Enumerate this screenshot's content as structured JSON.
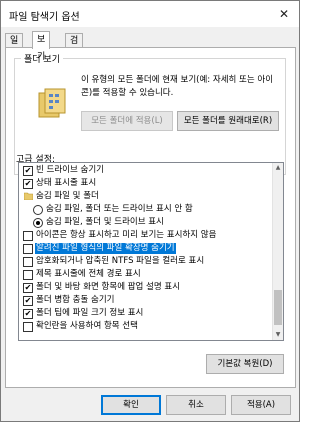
{
  "window": {
    "title": "파일 탐색기 옵션",
    "close_glyph": "✕"
  },
  "tabs": [
    {
      "label": "일반"
    },
    {
      "label": "보기",
      "active": true
    },
    {
      "label": "검색"
    }
  ],
  "folder_view": {
    "group_label": "폴더 보기",
    "description": "이 유형의 모든 폴더에 현재 보기(예: 자세히 또는 아이콘)를 적용할 수 있습니다.",
    "apply_button": "모든 폴더에 적용(L)",
    "reset_button": "모든 폴더를 원래대로(R)"
  },
  "advanced": {
    "label": "고급 설정:",
    "items": [
      {
        "text": "빈 드라이브 숨기기",
        "kind": "checkbox",
        "checked": true
      },
      {
        "text": "상태 표시줄 표시",
        "kind": "checkbox",
        "checked": true
      },
      {
        "text": "숨김 파일 및 폴더",
        "kind": "folder"
      },
      {
        "text": "숨김 파일, 폴더 또는 드라이브 표시 안 함",
        "kind": "radio",
        "checked": false
      },
      {
        "text": "숨김 파일, 폴더 및 드라이브 표시",
        "kind": "radio",
        "checked": true
      },
      {
        "text": "아이콘은 항상 표시하고 미리 보기는 표시하지 않음",
        "kind": "checkbox",
        "checked": false
      },
      {
        "text": "알려진 파일 형식의 파일 확장명 숨기기",
        "kind": "checkbox",
        "checked": false,
        "highlighted": true
      },
      {
        "text": "암호화되거나 압축된 NTFS 파일을 컬러로 표시",
        "kind": "checkbox",
        "checked": false
      },
      {
        "text": "제목 표시줄에 전체 경로 표시",
        "kind": "checkbox",
        "checked": false
      },
      {
        "text": "폴더 및 바탕 화면 항목에 팝업 설명 표시",
        "kind": "checkbox",
        "checked": true
      },
      {
        "text": "폴더 병합 충돌 숨기기",
        "kind": "checkbox",
        "checked": true
      },
      {
        "text": "폴더 팁에 파일 크기 정보 표시",
        "kind": "checkbox",
        "checked": true
      },
      {
        "text": "확인란을 사용하여 항목 선택",
        "kind": "checkbox",
        "checked": false
      }
    ],
    "restore_button": "기본값 복원(D)"
  },
  "footer": {
    "ok": "확인",
    "cancel": "취소",
    "apply": "적용(A)"
  },
  "colors": {
    "selection": "#0078d7",
    "accent_border": "#0078d7"
  },
  "glyphs": {
    "check": "✔",
    "scroll_up": "▲",
    "scroll_down": "▼"
  }
}
